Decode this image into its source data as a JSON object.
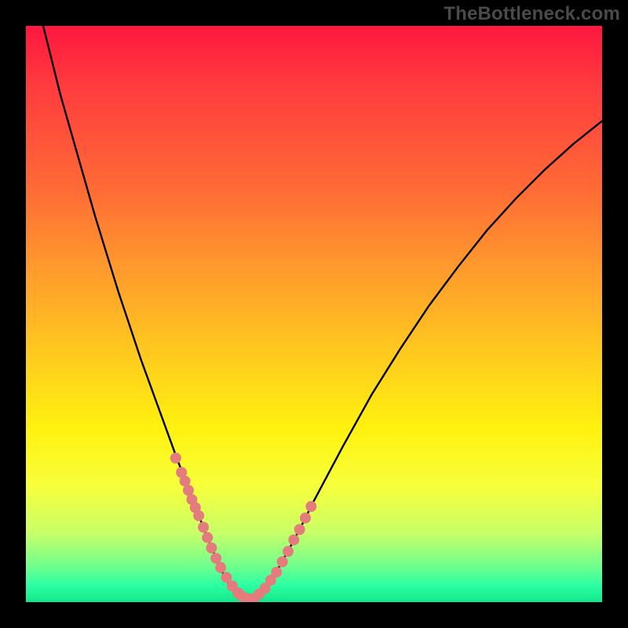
{
  "watermark": "TheBottleneck.com",
  "colors": {
    "frame_bg": "#000000",
    "curve_stroke": "#000000",
    "marker_fill": "#e47b7d",
    "watermark_text": "#4a4a4a"
  },
  "chart_data": {
    "type": "line",
    "title": "",
    "xlabel": "",
    "ylabel": "",
    "xlim": [
      0,
      100
    ],
    "ylim": [
      0,
      100
    ],
    "x": [
      0,
      2,
      4,
      6,
      8,
      10,
      12,
      14,
      16,
      18,
      20,
      22,
      24,
      26,
      28,
      30,
      32,
      33,
      34,
      35,
      36,
      37,
      38,
      39,
      40,
      42,
      44,
      46,
      48,
      50,
      55,
      60,
      65,
      70,
      75,
      80,
      85,
      90,
      95,
      100
    ],
    "y": [
      112,
      104,
      96,
      88,
      81,
      74,
      67,
      60.5,
      54,
      48,
      42,
      36.5,
      31,
      25.5,
      20.2,
      15,
      10,
      7.6,
      5.4,
      3.5,
      2,
      1,
      0.5,
      0.6,
      1.2,
      3.2,
      6.2,
      9.8,
      13.6,
      17.6,
      27,
      36,
      44,
      51.5,
      58.2,
      64.5,
      70,
      75,
      79.5,
      83.5
    ],
    "series_name": "bottleneck-curve",
    "markers": {
      "x": [
        26.0,
        27.0,
        27.6,
        28.2,
        28.8,
        29.4,
        30.0,
        30.8,
        31.5,
        32.2,
        33.0,
        33.8,
        34.8,
        35.8,
        36.8,
        37.5,
        38.5,
        39.5,
        40.5,
        41.5,
        42.5,
        43.5,
        44.5,
        45.5,
        46.5,
        47.5,
        48.5,
        49.5
      ],
      "y": [
        25.0,
        22.5,
        21.0,
        19.4,
        17.8,
        16.4,
        15.0,
        13.0,
        11.2,
        9.4,
        7.6,
        6.0,
        4.3,
        2.8,
        1.6,
        1.0,
        0.6,
        0.6,
        1.4,
        2.4,
        3.8,
        5.2,
        7.0,
        8.8,
        10.8,
        12.6,
        14.6,
        16.6
      ]
    }
  }
}
